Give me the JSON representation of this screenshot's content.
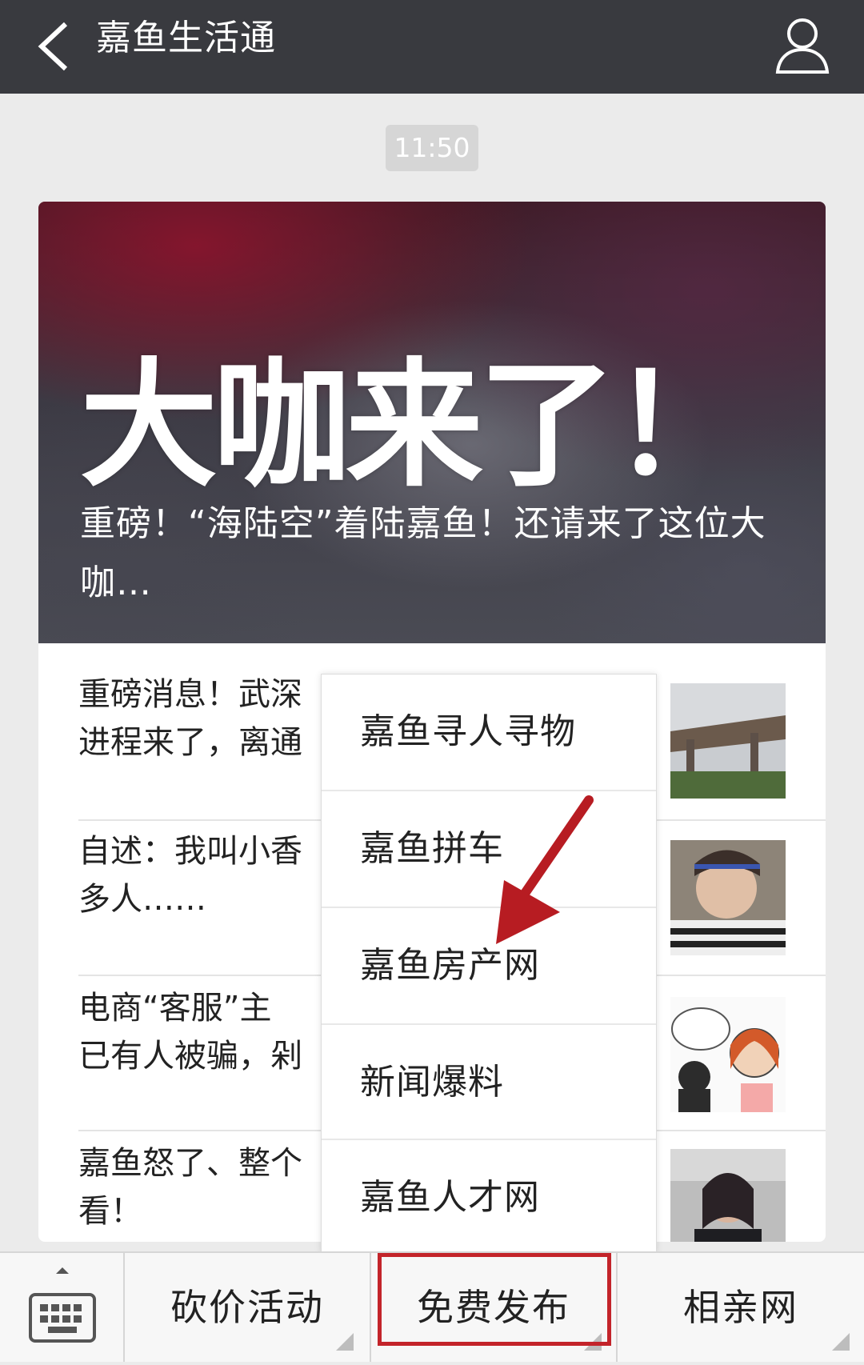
{
  "header": {
    "title": "嘉鱼生活通",
    "back_icon": "chevron-left-icon",
    "profile_icon": "person-icon"
  },
  "timestamp": "11:50",
  "cover": {
    "big_text": "大咖来了！",
    "title": "重磅！“海陆空”着陆嘉鱼！还请来了这位大咖…"
  },
  "articles": [
    {
      "text": "重磅消息！武深\n进程来了，离通"
    },
    {
      "text": "自述：我叫小香\n多人……"
    },
    {
      "text": "电商“客服”主\n已有人被骗，剁"
    },
    {
      "text": "嘉鱼怒了、整个\n看！"
    }
  ],
  "popup_menu": {
    "items": [
      "嘉鱼寻人寻物",
      "嘉鱼拼车",
      "嘉鱼房产网",
      "新闻爆料",
      "嘉鱼人才网"
    ]
  },
  "bottom_menu": {
    "keyboard_icon": "keyboard-icon",
    "items": [
      "砍价活动",
      "免费发布",
      "相亲网"
    ]
  },
  "colors": {
    "header_bg": "#393a3f",
    "highlight": "#c3242a"
  }
}
